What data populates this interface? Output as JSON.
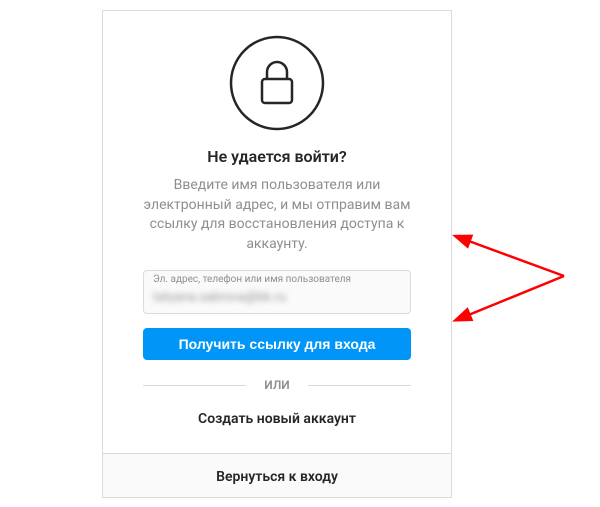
{
  "title": "Не удается войти?",
  "description": "Введите имя пользователя или электронный адрес, и мы отправим вам ссылку для восстановления доступа к аккаунту.",
  "input": {
    "floating_label": "Эл. адрес, телефон или имя пользователя",
    "value_obscured": "tatyana.sabrova@bk.ru"
  },
  "submit_label": "Получить ссылку для входа",
  "divider_label": "или",
  "create_account_label": "Создать новый аккаунт",
  "back_label": "Вернуться к входу",
  "colors": {
    "primary": "#0095f6",
    "border": "#dbdbdb",
    "text_secondary": "#8e8e8e"
  }
}
